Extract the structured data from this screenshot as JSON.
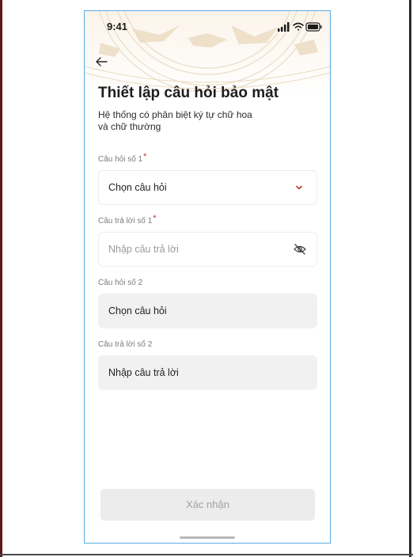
{
  "status_bar": {
    "time": "9:41",
    "icons": [
      "signal-icon",
      "wifi-icon",
      "battery-icon"
    ]
  },
  "header": {
    "back_icon": "arrow-left-icon"
  },
  "page": {
    "title": "Thiết lập câu hỏi bảo mật",
    "subtitle_line1": "Hệ thống có phân biệt ký tự chữ hoa",
    "subtitle_line2": "và chữ thường"
  },
  "form": {
    "q1": {
      "label": "Câu hỏi số 1",
      "required_mark": "*",
      "value": "Chọn câu hỏi",
      "icon": "chevron-down-icon"
    },
    "a1": {
      "label": "Câu trả lời số 1",
      "required_mark": "*",
      "placeholder": "Nhập câu trả lời",
      "icon": "eye-off-icon"
    },
    "q2": {
      "label": "Câu hỏi số 2",
      "value": "Chọn câu hỏi"
    },
    "a2": {
      "label": "Câu trả lời số 2",
      "value": "Nhập câu trả lời"
    }
  },
  "confirm_button": {
    "label": "Xác nhận"
  },
  "colors": {
    "required": "#d0302a",
    "frame_border": "#57aee6",
    "disabled_button_bg": "#ececec",
    "disabled_field_bg": "#f1f1f1",
    "decor": "#e9d9c0"
  }
}
